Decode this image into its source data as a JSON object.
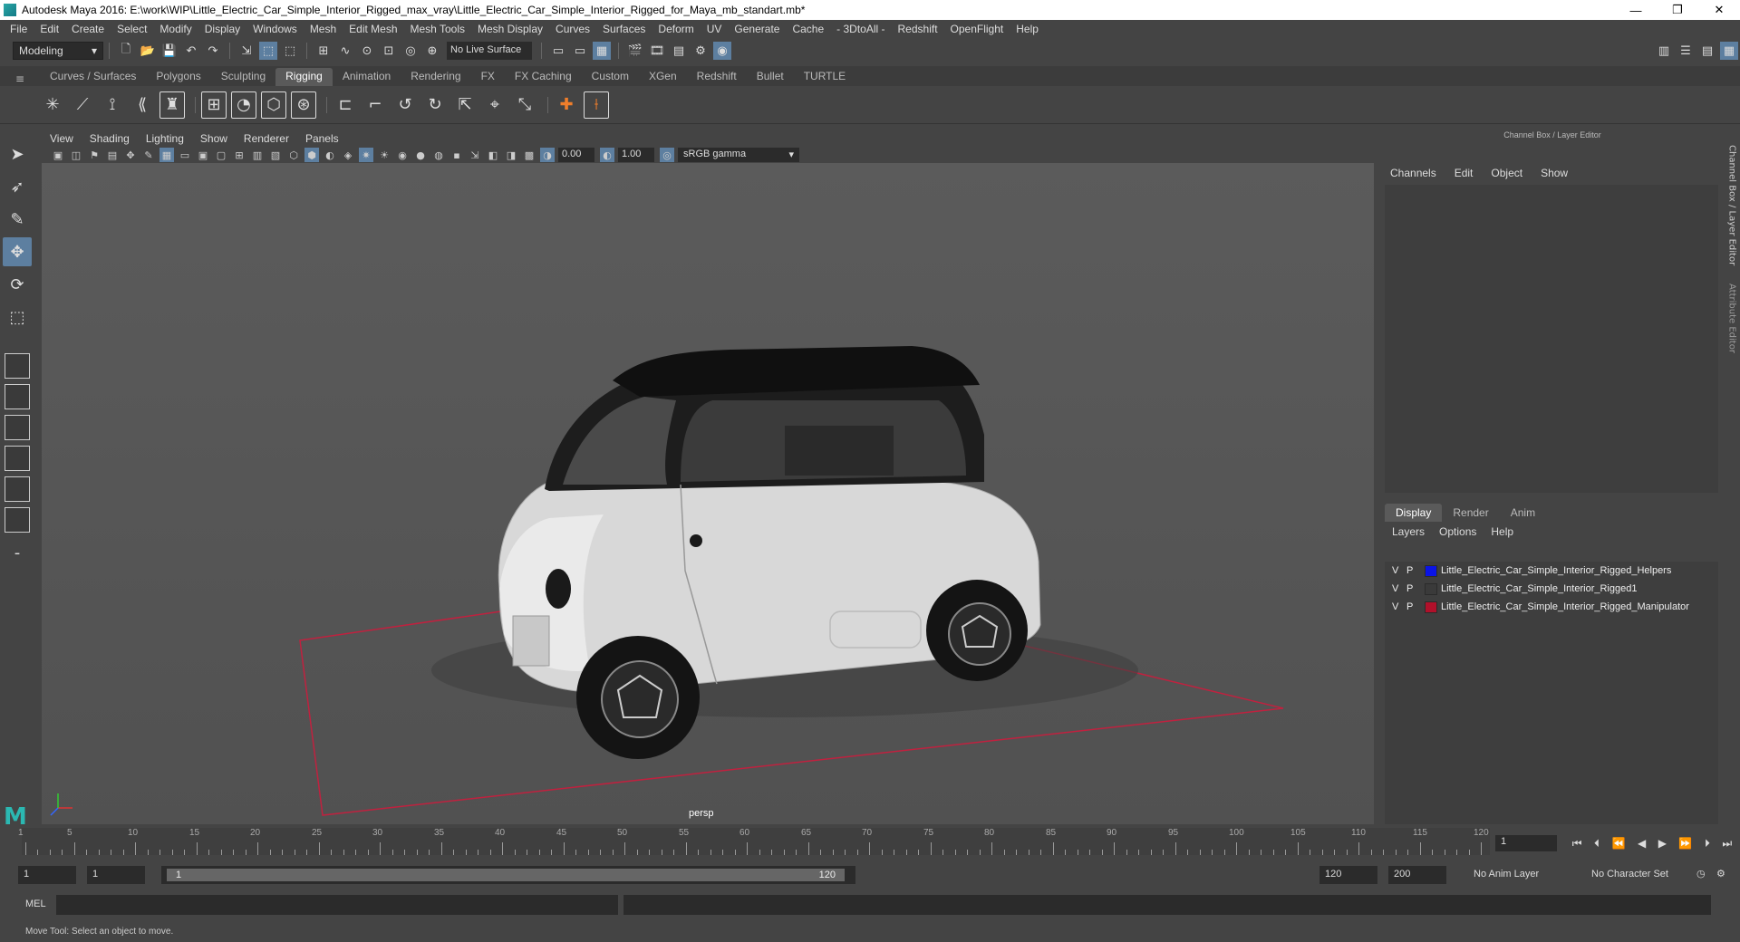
{
  "window": {
    "title": "Autodesk Maya 2016: E:\\work\\WIP\\Little_Electric_Car_Simple_Interior_Rigged_max_vray\\Little_Electric_Car_Simple_Interior_Rigged_for_Maya_mb_standart.mb*",
    "minimize": "—",
    "restore": "❐",
    "close": "✕"
  },
  "menus": [
    "File",
    "Edit",
    "Create",
    "Select",
    "Modify",
    "Display",
    "Windows",
    "Mesh",
    "Edit Mesh",
    "Mesh Tools",
    "Mesh Display",
    "Curves",
    "Surfaces",
    "Deform",
    "UV",
    "Generate",
    "Cache",
    "- 3DtoAll -",
    "Redshift",
    "OpenFlight",
    "Help"
  ],
  "statusline": {
    "mode": "Modeling",
    "live_surface": "No Live Surface"
  },
  "shelf_tabs": [
    "Curves / Surfaces",
    "Polygons",
    "Sculpting",
    "Rigging",
    "Animation",
    "Rendering",
    "FX",
    "FX Caching",
    "Custom",
    "XGen",
    "Redshift",
    "Bullet",
    "TURTLE"
  ],
  "shelf_active": "Rigging",
  "panel_menu": [
    "View",
    "Shading",
    "Lighting",
    "Show",
    "Renderer",
    "Panels"
  ],
  "panel_fields": {
    "exposure": "0.00",
    "gamma": "1.00",
    "color_space": "sRGB gamma"
  },
  "viewport": {
    "camera": "persp",
    "grid_color": "#c0213f"
  },
  "channel_box": {
    "header": "Channel Box / Layer Editor",
    "menus": [
      "Channels",
      "Edit",
      "Object",
      "Show"
    ],
    "side_tab": "Channel Box / Layer Editor",
    "side_tab2": "Attribute Editor"
  },
  "layer_editor": {
    "tabs": [
      "Display",
      "Render",
      "Anim"
    ],
    "active_tab": "Display",
    "menus": [
      "Layers",
      "Options",
      "Help"
    ],
    "layers": [
      {
        "v": "V",
        "p": "P",
        "color": "#0a14e6",
        "name": "Little_Electric_Car_Simple_Interior_Rigged_Helpers"
      },
      {
        "v": "V",
        "p": "P",
        "color": "#3a3a3a",
        "name": "Little_Electric_Car_Simple_Interior_Rigged1"
      },
      {
        "v": "V",
        "p": "P",
        "color": "#b0102a",
        "name": "Little_Electric_Car_Simple_Interior_Rigged_Manipulator"
      }
    ]
  },
  "timeline": {
    "ticks": [
      "1",
      "5",
      "10",
      "15",
      "20",
      "25",
      "30",
      "35",
      "40",
      "45",
      "50",
      "55",
      "60",
      "65",
      "70",
      "75",
      "80",
      "85",
      "90",
      "95",
      "100",
      "105",
      "110",
      "115",
      "120"
    ],
    "current_frame": "1"
  },
  "range": {
    "start": "1",
    "playback_start": "1",
    "slider_start": "1",
    "slider_end": "120",
    "playback_end": "120",
    "end": "200",
    "anim_layer": "No Anim Layer",
    "character_set": "No Character Set"
  },
  "mel_label": "MEL",
  "help_line": "Move Tool: Select an object to move."
}
